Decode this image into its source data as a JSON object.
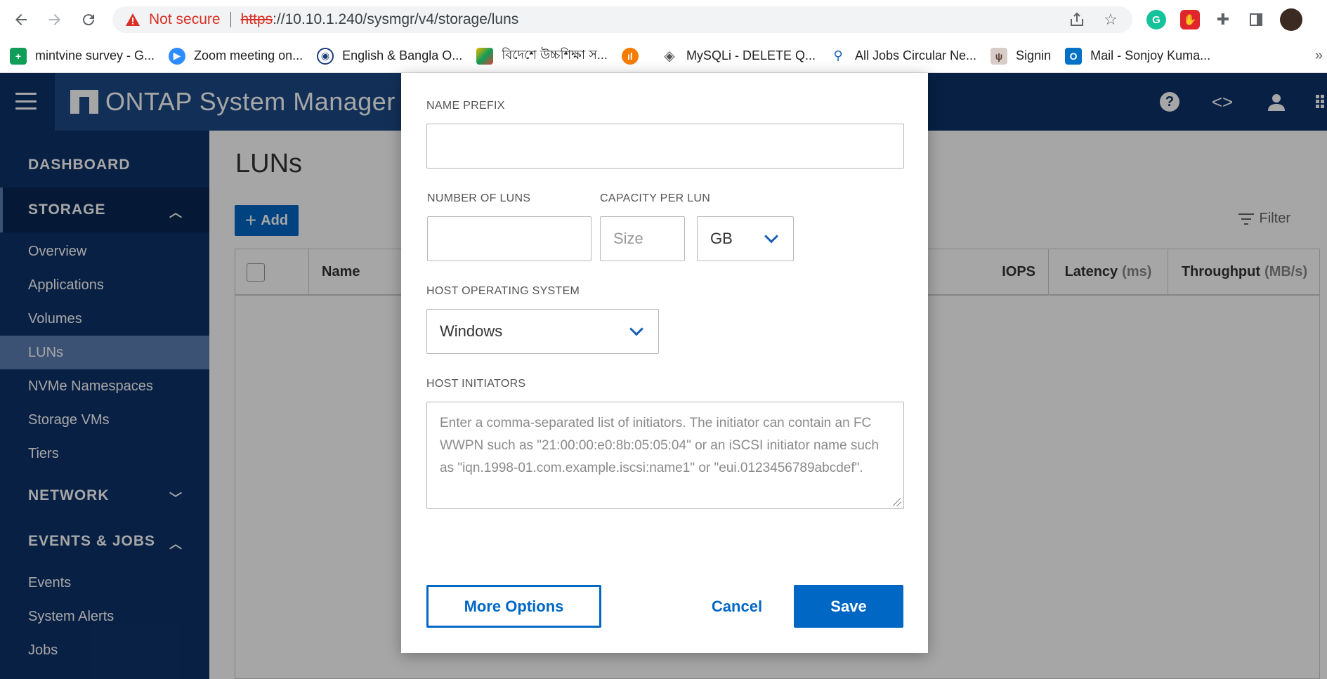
{
  "browser": {
    "security_label": "Not secure",
    "url_scheme": "https",
    "url_rest": "://10.10.1.240/sysmgr/v4/storage/luns",
    "bookmarks": [
      {
        "label": "mintvine survey - G...",
        "icon": "plus-sheet-icon",
        "color": "#0f9d58"
      },
      {
        "label": "Zoom meeting on...",
        "icon": "video-camera-icon",
        "color": "#2d8cff"
      },
      {
        "label": "English & Bangla O...",
        "icon": "globe-seal-icon",
        "color": "#1a3d7c"
      },
      {
        "label": "বিদেশে উচ্চশিক্ষা স...",
        "icon": "colorful-shape-icon",
        "color": "#f4b400"
      },
      {
        "label": "",
        "icon": "chart-bars-icon",
        "color": "#f57c00"
      },
      {
        "label": "MySQLi - DELETE Q...",
        "icon": "diamond-icon",
        "color": "#555555"
      },
      {
        "label": "All Jobs Circular Ne...",
        "icon": "figure-icon",
        "color": "#1565c0"
      },
      {
        "label": "Signin",
        "icon": "deer-icon",
        "color": "#8d6e63"
      },
      {
        "label": "Mail - Sonjoy Kuma...",
        "icon": "outlook-icon",
        "color": "#0072c6"
      }
    ],
    "bookmarks_more": "»"
  },
  "app": {
    "title": "ONTAP System Manager",
    "sidebar": {
      "sections": [
        {
          "label": "DASHBOARD",
          "chevron": ""
        },
        {
          "label": "STORAGE",
          "chevron": "up"
        },
        {
          "label": "NETWORK",
          "chevron": "down"
        },
        {
          "label": "EVENTS & JOBS",
          "chevron": "up"
        }
      ],
      "storage_items": [
        "Overview",
        "Applications",
        "Volumes",
        "LUNs",
        "NVMe Namespaces",
        "Storage VMs",
        "Tiers"
      ],
      "events_items": [
        "Events",
        "System Alerts",
        "Jobs"
      ],
      "selected_item": "LUNs"
    },
    "page_title": "LUNs",
    "add_label": "Add",
    "filter_label": "Filter",
    "table": {
      "columns": {
        "name": "Name",
        "iops": "IOPS",
        "latency": "Latency",
        "latency_unit": "(ms)",
        "throughput": "Throughput",
        "throughput_unit": "(MB/s)"
      }
    }
  },
  "modal": {
    "name_prefix_label": "NAME PREFIX",
    "name_prefix_value": "",
    "number_of_luns_label": "NUMBER OF LUNS",
    "number_of_luns_value": "",
    "capacity_label": "CAPACITY PER LUN",
    "size_placeholder": "Size",
    "unit_value": "GB",
    "host_os_label": "HOST OPERATING SYSTEM",
    "host_os_value": "Windows",
    "host_initiators_label": "HOST INITIATORS",
    "host_initiators_placeholder": "Enter a comma-separated list of initiators. The initiator can contain an FC WWPN such as \"21:00:00:e0:8b:05:05:04\" or an iSCSI initiator name such as \"iqn.1998-01.com.example.iscsi:name1\" or \"eui.0123456789abcdef\".",
    "more_options_label": "More Options",
    "cancel_label": "Cancel",
    "save_label": "Save"
  }
}
